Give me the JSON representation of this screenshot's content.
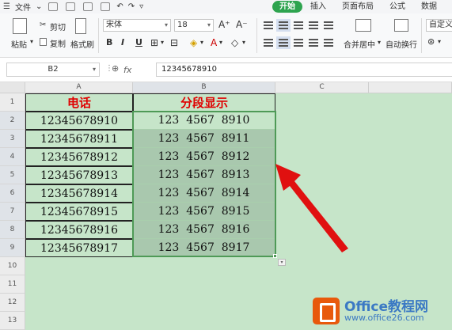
{
  "menubar": {
    "file_label": "文件",
    "tabs": [
      "开始",
      "插入",
      "页面布局",
      "公式",
      "数据"
    ]
  },
  "ribbon": {
    "paste": "粘贴",
    "cut": "剪切",
    "copy": "复制",
    "format_painter": "格式刷",
    "font_name": "宋体",
    "font_size": "18",
    "bold": "B",
    "italic": "I",
    "underline": "U",
    "merge_center": "合并居中",
    "wrap_text": "自动换行",
    "custom": "自定义"
  },
  "formula_bar": {
    "name_box": "B2",
    "fx": "fx",
    "value": "12345678910"
  },
  "sheet": {
    "columns": [
      "A",
      "B",
      "C"
    ],
    "rows": [
      "1",
      "2",
      "3",
      "4",
      "5",
      "6",
      "7",
      "8",
      "9",
      "10",
      "11",
      "12",
      "13"
    ],
    "headers": [
      "电话",
      "分段显示"
    ],
    "data": [
      [
        "12345678910",
        "123  4567  8910"
      ],
      [
        "12345678911",
        "123  4567  8911"
      ],
      [
        "12345678912",
        "123  4567  8912"
      ],
      [
        "12345678913",
        "123  4567  8913"
      ],
      [
        "12345678914",
        "123  4567  8914"
      ],
      [
        "12345678915",
        "123  4567  8915"
      ],
      [
        "12345678916",
        "123  4567  8916"
      ],
      [
        "12345678917",
        "123  4567  8917"
      ]
    ]
  },
  "watermark": {
    "line1": "Office教程网",
    "line2": "www.office26.com"
  },
  "colors": {
    "tab_active": "#2ea44f",
    "sheet_bg": "#c6e5c9",
    "selected_cells": "#a9c8ae",
    "header_text": "#e00000",
    "arrow": "#e01010"
  }
}
